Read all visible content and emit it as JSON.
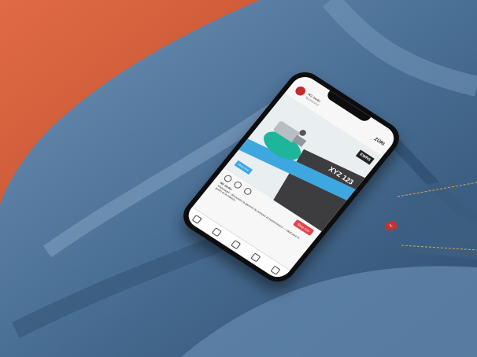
{
  "scene": {
    "background_colors": {
      "denim": "#4a6f95",
      "denim_light": "#6f92b5",
      "denim_dark": "#2e4d6e",
      "orange_fabric": "#d85f3b",
      "tab_red": "#c4322f"
    }
  },
  "phone": {
    "header": {
      "account_name": "W2 Jardin",
      "account_sub": "Sponsored",
      "logo_text": "ZÜRI"
    },
    "post": {
      "brand_badge": "EWRS",
      "model_text": "XYZ 123",
      "tag_text": "Shop now"
    },
    "actions": {
      "cta_label": "Shop now"
    },
    "caption": {
      "username": "W2 Jardin",
      "text": "Nouveauté : découvrez la gamme de pompes et surpresseurs — idéal pour le jardin et la maison."
    }
  },
  "jeans_tag_text": "L"
}
